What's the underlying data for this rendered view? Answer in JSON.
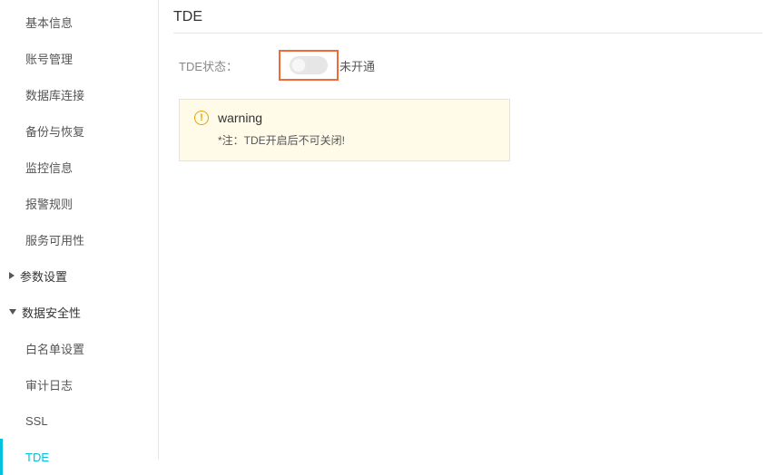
{
  "sidebar": {
    "items": [
      {
        "label": "基本信息"
      },
      {
        "label": "账号管理"
      },
      {
        "label": "数据库连接"
      },
      {
        "label": "备份与恢复"
      },
      {
        "label": "监控信息"
      },
      {
        "label": "报警规则"
      },
      {
        "label": "服务可用性"
      },
      {
        "label": "参数设置"
      },
      {
        "label": "数据安全性"
      }
    ],
    "security_children": [
      {
        "label": "白名单设置"
      },
      {
        "label": "审计日志"
      },
      {
        "label": "SSL"
      },
      {
        "label": "TDE"
      }
    ]
  },
  "main": {
    "title": "TDE",
    "status_label": "TDE状态：",
    "status_value": "未开通",
    "alert": {
      "title": "warning",
      "body": "*注：TDE开启后不可关闭!"
    }
  },
  "icons": {
    "warning_glyph": "!"
  }
}
